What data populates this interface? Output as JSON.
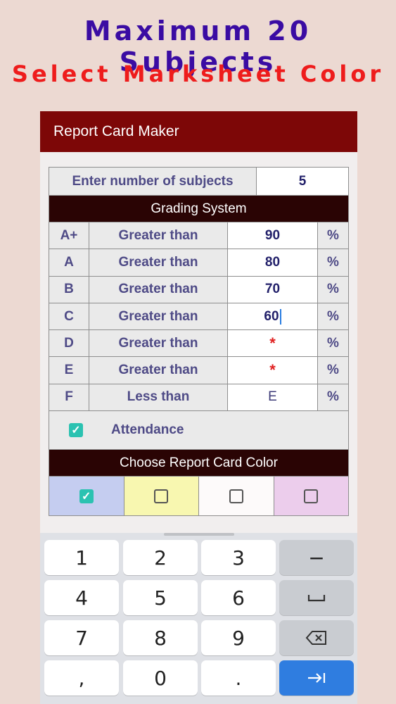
{
  "banner": {
    "line1": "Maximum 20 Subjects",
    "line1_color": "#3a0ca3",
    "line2": "Select Marksheet Color",
    "line2_color": "#ee1c1c"
  },
  "app": {
    "title": "Report Card Maker",
    "bar_color": "#7d0707"
  },
  "subjects": {
    "label": "Enter number of subjects",
    "value": "5"
  },
  "grading": {
    "header": "Grading System",
    "header_color": "#2a0404",
    "rows": [
      {
        "grade": "A+",
        "condition": "Greater than",
        "value": "90",
        "unit": "%"
      },
      {
        "grade": "A",
        "condition": "Greater than",
        "value": "80",
        "unit": "%"
      },
      {
        "grade": "B",
        "condition": "Greater than",
        "value": "70",
        "unit": "%"
      },
      {
        "grade": "C",
        "condition": "Greater than",
        "value": "60",
        "unit": "%"
      },
      {
        "grade": "D",
        "condition": "Greater than",
        "value": "*",
        "unit": "%"
      },
      {
        "grade": "E",
        "condition": "Greater than",
        "value": "*",
        "unit": "%"
      },
      {
        "grade": "F",
        "condition": "Less than",
        "value": "E",
        "unit": "%"
      }
    ]
  },
  "attendance": {
    "label": "Attendance",
    "checked": true
  },
  "color_choice": {
    "header": "Choose Report Card Color",
    "options": [
      {
        "color": "#c5cdf0",
        "checked": true
      },
      {
        "color": "#f8f7b0",
        "checked": false
      },
      {
        "color": "#fdfafa",
        "checked": false
      },
      {
        "color": "#eccdec",
        "checked": false
      }
    ]
  },
  "keyboard": {
    "keys": [
      [
        "1",
        "2",
        "3",
        "−"
      ],
      [
        "4",
        "5",
        "6",
        "space-icon"
      ],
      [
        "7",
        "8",
        "9",
        "backspace-icon"
      ],
      [
        ",",
        "0",
        ".",
        "next-field-icon"
      ]
    ],
    "enter_color": "#2f7de0"
  }
}
